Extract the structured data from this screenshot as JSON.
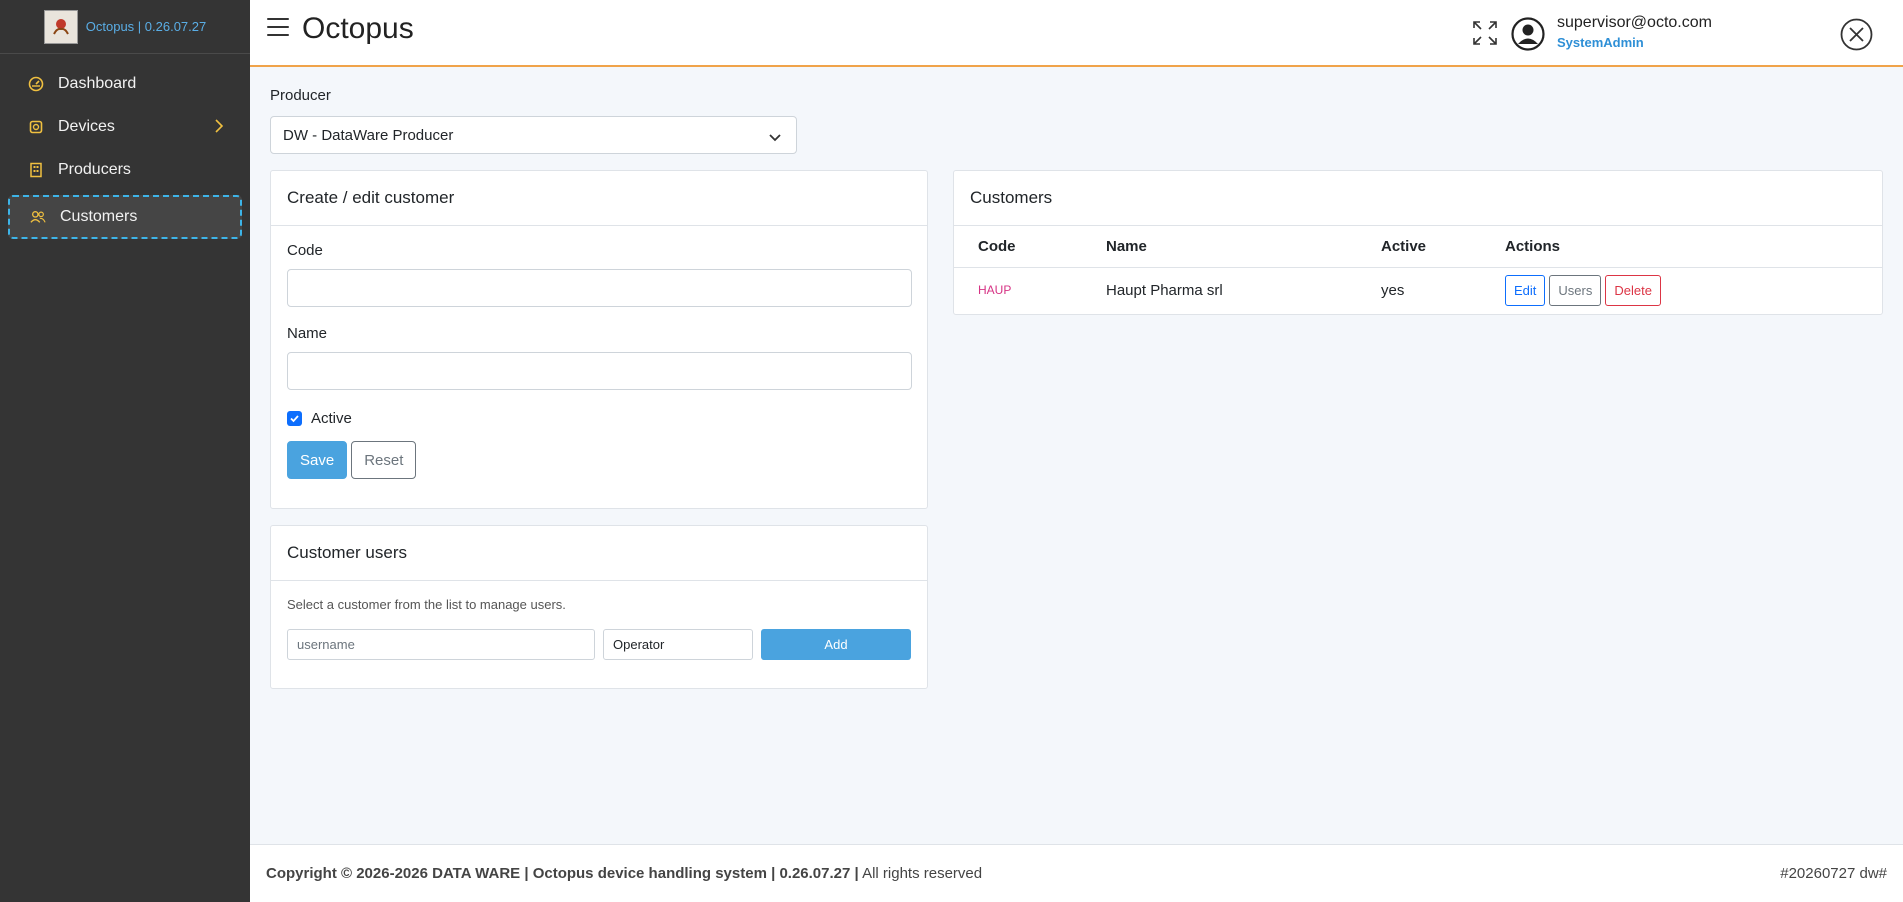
{
  "sidebar": {
    "brand_text": "Octopus | 0.26.07.27",
    "items": [
      {
        "label": "Dashboard",
        "icon": "gauge-icon"
      },
      {
        "label": "Devices",
        "icon": "chip-icon"
      },
      {
        "label": "Producers",
        "icon": "building-icon"
      },
      {
        "label": "Customers",
        "icon": "users-icon"
      }
    ],
    "accent_color": "#f0c040"
  },
  "header": {
    "title": "Octopus",
    "user_email": "supervisor@octo.com",
    "user_role": "SystemAdmin"
  },
  "producer": {
    "label": "Producer",
    "selected": "DW - DataWare Producer"
  },
  "edit_form": {
    "title": "Create / edit customer",
    "code_label": "Code",
    "code_value": "",
    "name_label": "Name",
    "name_value": "",
    "active_label": "Active",
    "active_checked": true,
    "save_label": "Save",
    "reset_label": "Reset"
  },
  "customer_users": {
    "title": "Customer users",
    "help": "Select a customer from the list to manage users.",
    "username_placeholder": "username",
    "role_value": "Operator",
    "add_label": "Add"
  },
  "customers": {
    "title": "Customers",
    "columns": [
      "Code",
      "Name",
      "Active",
      "Actions"
    ],
    "rows": [
      {
        "code": "HAUP",
        "name": "Haupt Pharma srl",
        "active": "yes"
      }
    ],
    "edit_label": "Edit",
    "users_label": "Users",
    "delete_label": "Delete"
  },
  "footer": {
    "copyright": "Copyright © 2026-2026 DATA WARE | Octopus device handling system | 0.26.07.27 |",
    "rights": "All rights reserved",
    "build": "#20260727 dw#"
  }
}
